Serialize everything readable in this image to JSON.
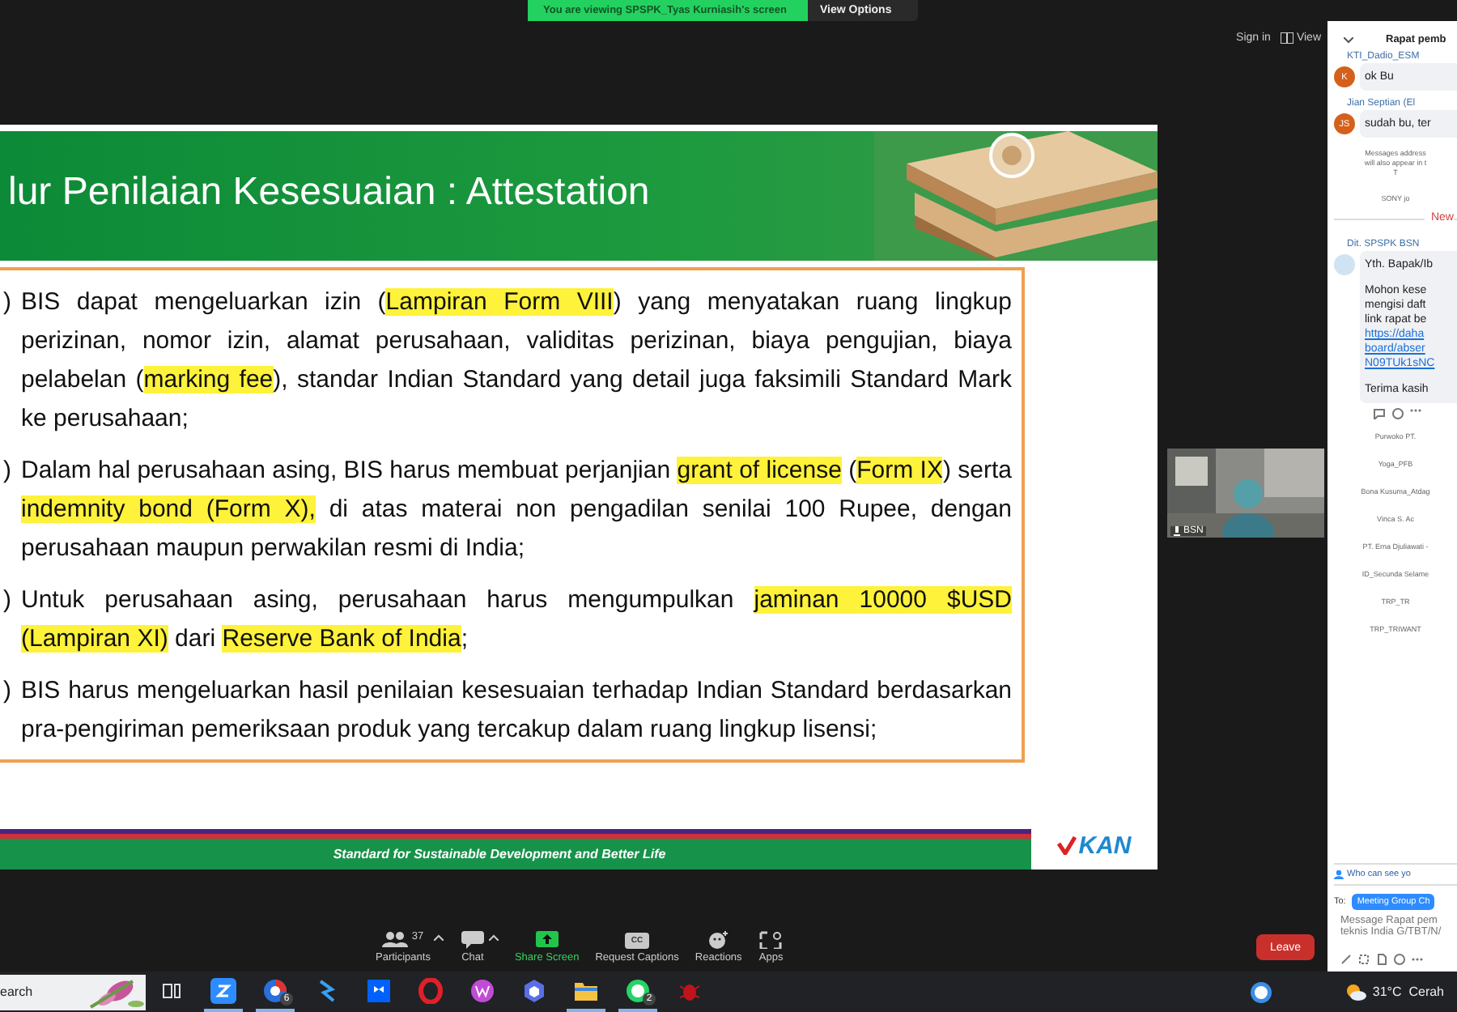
{
  "banner": {
    "text": "You are viewing SPSPK_Tyas Kurniasih's screen",
    "button": "View Options"
  },
  "top_controls": [
    {
      "label": "Sign in",
      "kind": "text"
    },
    {
      "label": "View",
      "kind": "grid"
    }
  ],
  "slide": {
    "title": "lur Penilaian Kesesuaian : Attestation",
    "items": [
      {
        "marker": ")",
        "segments": [
          {
            "text": "BIS dapat mengeluarkan izin (",
            "highlight": false
          },
          {
            "text": "Lampiran Form VIII",
            "highlight": true
          },
          {
            "text": ") yang menyatakan ruang lingkup perizinan, nomor izin, alamat perusahaan, validitas perizinan, biaya pengujian, biaya pelabelan (",
            "highlight": false
          },
          {
            "text": "marking fee",
            "highlight": true
          },
          {
            "text": "), standar Indian Standard yang detail juga faksimili Standard Mark ke perusahaan;",
            "highlight": false
          }
        ]
      },
      {
        "marker": ")",
        "segments": [
          {
            "text": "Dalam hal perusahaan asing, BIS harus membuat perjanjian ",
            "highlight": false
          },
          {
            "text": "grant of license",
            "highlight": true
          },
          {
            "text": " (",
            "highlight": false
          },
          {
            "text": "Form IX",
            "highlight": true
          },
          {
            "text": ") serta ",
            "highlight": false
          },
          {
            "text": "indemnity bond (Form X),",
            "highlight": true
          },
          {
            "text": " di atas materai non pengadilan senilai 100 Rupee, dengan perusahaan maupun perwakilan resmi di India;",
            "highlight": false
          }
        ]
      },
      {
        "marker": ")",
        "segments": [
          {
            "text": "Untuk perusahaan asing, perusahaan harus mengumpulkan ",
            "highlight": false
          },
          {
            "text": "jaminan 10000 $USD (Lampiran XI)",
            "highlight": true
          },
          {
            "text": " dari ",
            "highlight": false
          },
          {
            "text": "Reserve Bank of India",
            "highlight": true
          },
          {
            "text": ";",
            "highlight": false
          }
        ]
      },
      {
        "marker": ")",
        "segments": [
          {
            "text": "BIS harus mengeluarkan hasil penilaian kesesuaian terhadap Indian Standard berdasarkan pra-pengiriman pemeriksaan produk yang tercakup dalam ruang lingkup lisensi;",
            "highlight": false
          }
        ]
      }
    ],
    "footer": "Standard for Sustainable Development and Better Life",
    "logo": "KAN"
  },
  "video": {
    "name": "BSN"
  },
  "toolbar": {
    "items": [
      {
        "kind": "participants",
        "label": "Participants",
        "count": "37",
        "menu": true
      },
      {
        "kind": "chat",
        "label": "Chat",
        "menu": true
      },
      {
        "kind": "share",
        "label": "Share Screen",
        "menu": false
      },
      {
        "kind": "captions",
        "label": "Request Captions",
        "badge": "CC",
        "menu": false
      },
      {
        "kind": "reactions",
        "label": "Reactions",
        "menu": false
      },
      {
        "kind": "apps",
        "label": "Apps",
        "menu": false
      }
    ],
    "leave": "Leave"
  },
  "chat": {
    "title": "Rapat pemb",
    "entries": [
      {
        "kind": "message",
        "sender": "KTI_Dadio_ESM",
        "initials": "K",
        "color": "#d4601c",
        "paragraphs": [
          [
            "ok Bu"
          ]
        ]
      },
      {
        "kind": "message",
        "sender": "Jian Septian (El",
        "initials": "JS",
        "color": "#d4601c",
        "paragraphs": [
          [
            "sudah bu, ter"
          ]
        ]
      },
      {
        "kind": "system",
        "lines": [
          "Messages address",
          "will also appear in t",
          "T"
        ]
      },
      {
        "kind": "notice",
        "text": "SONY jo"
      },
      {
        "kind": "divider",
        "text": "New"
      },
      {
        "kind": "message",
        "sender": "Dit. SPSPK BSN",
        "color": "#cfe3f3",
        "paragraphs": [
          [
            "Yth. Bapak/Ib"
          ],
          [
            "Mohon kese",
            "mengisi daft",
            "link rapat be"
          ]
        ],
        "links": [
          "https://daha",
          "board/abser",
          "N09TUk1sNC"
        ],
        "after": [
          "Terima kasih"
        ],
        "reactions": true
      },
      {
        "kind": "notice",
        "text": "Purwoko PT."
      },
      {
        "kind": "notice",
        "text": "Yoga_PFB"
      },
      {
        "kind": "notice",
        "text": "Bona Kusuma_Atdag"
      },
      {
        "kind": "notice",
        "text": "Vinca S. Ac"
      },
      {
        "kind": "notice",
        "text": "PT. Erna Djuliawati -"
      },
      {
        "kind": "notice",
        "text": "ID_Secunda Selame"
      },
      {
        "kind": "notice",
        "text": "TRP_TR"
      },
      {
        "kind": "notice",
        "text": "TRP_TRIWANT"
      }
    ],
    "who": "Who can see yo",
    "to_label": "To:",
    "recipient": "Meeting Group Ch",
    "placeholder": "Message Rapat pem teknis India G/TBT/N/"
  },
  "taskbar": {
    "search": "earch",
    "apps": [
      {
        "kind": "taskview",
        "active": false
      },
      {
        "kind": "zoom",
        "active": true
      },
      {
        "kind": "chrome",
        "active": true,
        "badge": "6"
      },
      {
        "kind": "bolt",
        "active": false
      },
      {
        "kind": "dropbox",
        "active": false
      },
      {
        "kind": "opera",
        "active": false
      },
      {
        "kind": "office",
        "active": false
      },
      {
        "kind": "copilot",
        "active": false
      },
      {
        "kind": "folder",
        "active": true
      },
      {
        "kind": "whatsapp",
        "active": true,
        "badge": "2"
      },
      {
        "kind": "bug",
        "active": false
      }
    ],
    "weather": "31°C  Cerah"
  }
}
